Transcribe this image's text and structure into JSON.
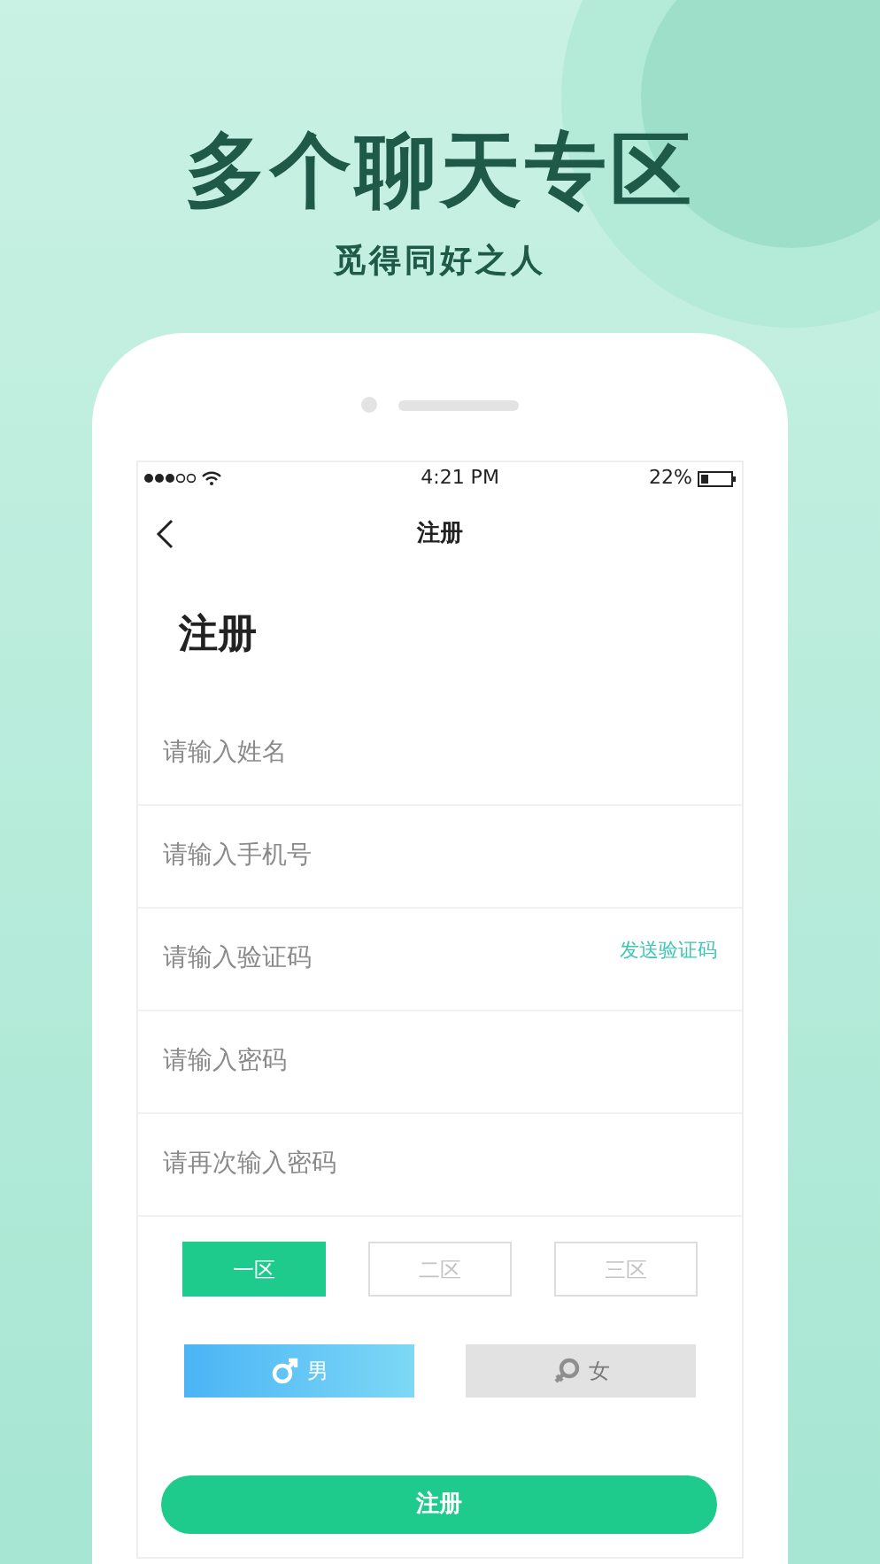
{
  "headline": "多个聊天专区",
  "subtitle": "觅得同好之人",
  "status_bar": {
    "time": "4:21 PM",
    "battery": "22%"
  },
  "nav": {
    "title": "注册"
  },
  "page_title": "注册",
  "fields": [
    {
      "placeholder": "请输入姓名"
    },
    {
      "placeholder": "请输入手机号"
    },
    {
      "placeholder": "请输入验证码",
      "action": "发送验证码"
    },
    {
      "placeholder": "请输入密码"
    },
    {
      "placeholder": "请再次输入密码"
    }
  ],
  "zones": [
    {
      "label": "一区",
      "selected": true
    },
    {
      "label": "二区",
      "selected": false
    },
    {
      "label": "三区",
      "selected": false
    }
  ],
  "genders": [
    {
      "kind": "male",
      "label": "男",
      "selected": true
    },
    {
      "kind": "female",
      "label": "女",
      "selected": false
    }
  ],
  "submit": "注册"
}
